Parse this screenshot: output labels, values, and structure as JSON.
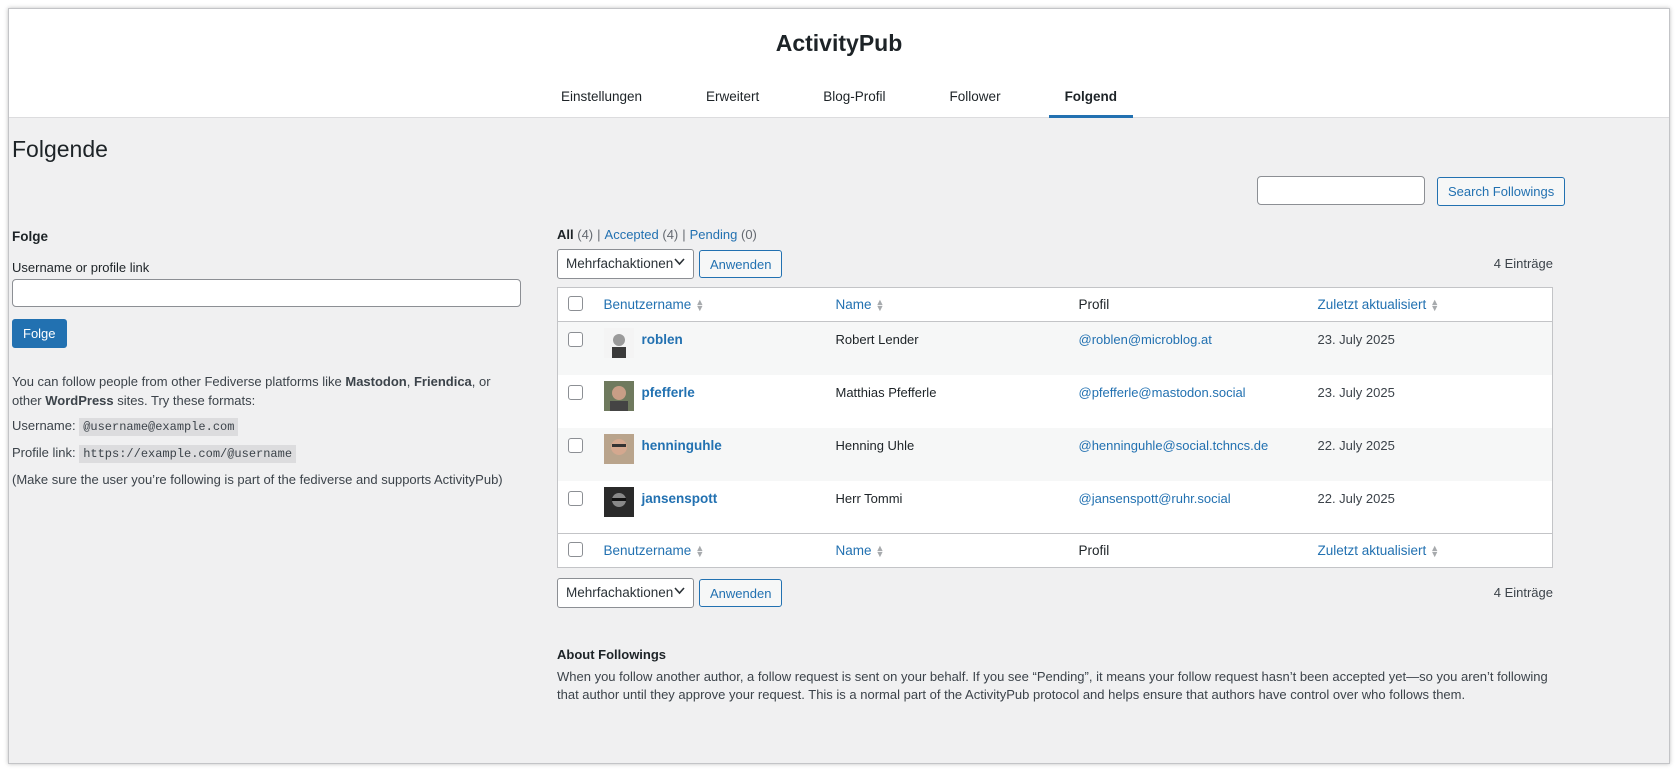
{
  "header": {
    "title": "ActivityPub",
    "tabs": [
      {
        "label": "Einstellungen"
      },
      {
        "label": "Erweitert"
      },
      {
        "label": "Blog-Profil"
      },
      {
        "label": "Follower"
      },
      {
        "label": "Folgend"
      }
    ]
  },
  "page_title": "Folgende",
  "search": {
    "button_label": "Search Followings",
    "placeholder": ""
  },
  "follow_form": {
    "heading": "Folge",
    "field_label": "Username or profile link",
    "button_label": "Folge",
    "help_intro_1": "You can follow people from other Fediverse platforms like ",
    "help_bold_1": "Mastodon",
    "help_sep_1": ", ",
    "help_bold_2": "Friendica",
    "help_intro_2": ", or other ",
    "help_bold_3": "WordPress",
    "help_intro_3": " sites. Try these formats:",
    "username_label": "Username:",
    "username_example": "@username@example.com",
    "profile_label": "Profile link:",
    "profile_example": "https://example.com/@username",
    "note": "(Make sure the user you’re following is part of the fediverse and supports ActivityPub)"
  },
  "views": {
    "all_label": "All",
    "all_count": "(4)",
    "accepted_label": "Accepted",
    "accepted_count": "(4)",
    "pending_label": "Pending",
    "pending_count": "(0)"
  },
  "tablenav": {
    "bulk_label": "Mehrfachaktionen",
    "apply_label": "Anwenden",
    "count_label": "4 Einträge"
  },
  "columns": {
    "username": "Benutzername",
    "name": "Name",
    "profile": "Profil",
    "updated": "Zuletzt aktualisiert"
  },
  "rows": [
    {
      "username": "roblen",
      "name": "Robert Lender",
      "profile": "@roblen@microblog.at",
      "date": "23. July 2025"
    },
    {
      "username": "pfefferle",
      "name": "Matthias Pfefferle",
      "profile": "@pfefferle@mastodon.social",
      "date": "23. July 2025"
    },
    {
      "username": "henninguhle",
      "name": "Henning Uhle",
      "profile": "@henninguhle@social.tchncs.de",
      "date": "22. July 2025"
    },
    {
      "username": "jansenspott",
      "name": "Herr Tommi",
      "profile": "@jansenspott@ruhr.social",
      "date": "22. July 2025"
    }
  ],
  "about": {
    "heading": "About Followings",
    "text": "When you follow another author, a follow request is sent on your behalf. If you see “Pending”, it means your follow request hasn’t been accepted yet—so you aren’t following that author until they approve your request. This is a normal part of the ActivityPub protocol and helps ensure that authors have control over who follows them."
  },
  "colors": {
    "accent": "#2271b1",
    "background": "#f0f0f1"
  }
}
